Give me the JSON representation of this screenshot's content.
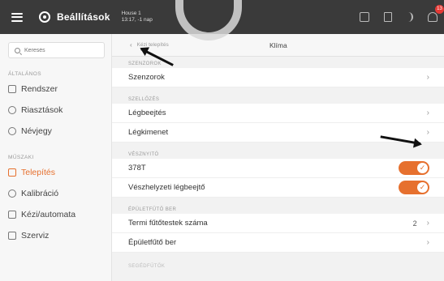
{
  "topbar": {
    "title": "Beállítások",
    "house_name": "House 1",
    "house_time": "13:17, -1 nap",
    "badge_count": "13"
  },
  "sidebar": {
    "search_placeholder": "Keresés",
    "sections": [
      {
        "label": "ÁLTALÁNOS"
      },
      {
        "label": "MŰSZAKI"
      }
    ],
    "items": [
      {
        "label": "Rendszer",
        "icon": "system-icon"
      },
      {
        "label": "Riasztások",
        "icon": "alarm-icon"
      },
      {
        "label": "Névjegy",
        "icon": "info-icon"
      },
      {
        "label": "Telepítés",
        "icon": "installation-icon",
        "active": true
      },
      {
        "label": "Kalibráció",
        "icon": "calibration-icon"
      },
      {
        "label": "Kézi/automata",
        "icon": "manual-auto-icon"
      },
      {
        "label": "Szerviz",
        "icon": "service-icon"
      }
    ]
  },
  "main": {
    "back_label": "Kézi telepítés",
    "title": "Klíma",
    "sections": [
      {
        "label": "SZENZOROK"
      },
      {
        "label": "SZELLŐZÉS"
      },
      {
        "label": "VÉSZNYITÓ"
      },
      {
        "label": "ÉPÜLETFŰTŐ BER"
      },
      {
        "label": "SEGÉDFŰTŐK"
      }
    ],
    "rows": [
      {
        "label": "Szenzorok"
      },
      {
        "label": "Légbeejtés"
      },
      {
        "label": "Légkimenet"
      },
      {
        "label": "378T",
        "toggle": true
      },
      {
        "label": "Vészhelyzeti légbeejtő",
        "toggle": true
      },
      {
        "label": "Termi fűtőtestek száma",
        "value": "2"
      },
      {
        "label": "Épületfűtő ber"
      }
    ]
  },
  "colors": {
    "accent": "#e6702e",
    "topbar": "#3a3a3a",
    "badge": "#e53935"
  }
}
